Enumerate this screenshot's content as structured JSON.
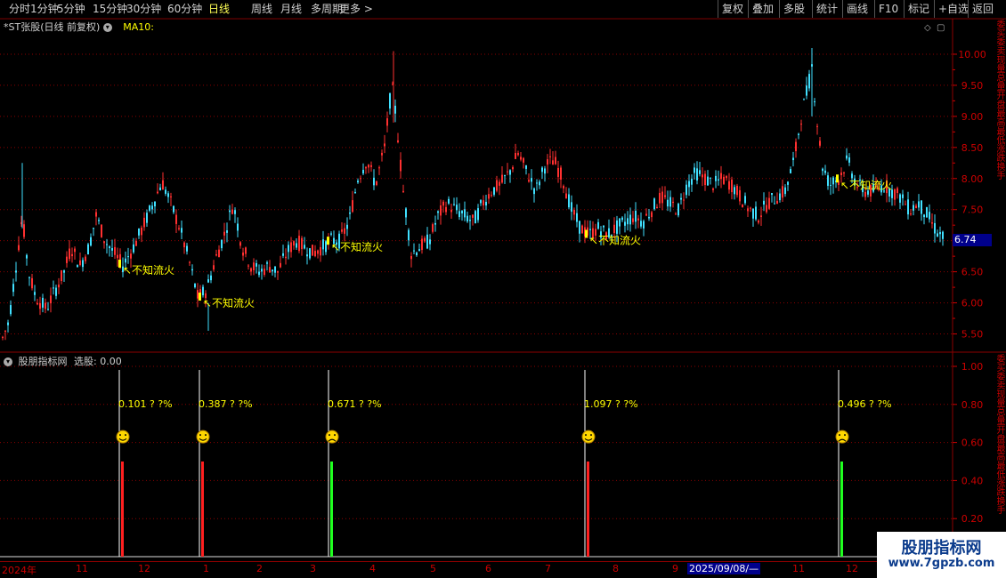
{
  "toolbar": {
    "periods": [
      {
        "label": "分时",
        "active": false
      },
      {
        "label": "1分钟",
        "active": false
      },
      {
        "label": "5分钟",
        "active": false
      },
      {
        "label": "15分钟",
        "active": false
      },
      {
        "label": "30分钟",
        "active": false
      },
      {
        "label": "60分钟",
        "active": false
      },
      {
        "label": "日线",
        "active": true
      },
      {
        "label": "周线",
        "active": false
      },
      {
        "label": "月线",
        "active": false
      },
      {
        "label": "多周期",
        "active": false
      },
      {
        "label": "更多 >",
        "active": false
      }
    ],
    "right_buttons": [
      "复权",
      "叠加",
      "多股",
      "统计",
      "画线",
      "F10",
      "标记",
      "+自选",
      "返回"
    ]
  },
  "main_chart": {
    "title": "*ST张股(日线 前复权)",
    "ma_label": "MA10:",
    "price_ticks": [
      "10.00",
      "9.50",
      "9.00",
      "8.50",
      "8.00",
      "7.50",
      "7.00",
      "6.50",
      "6.00",
      "5.50"
    ],
    "current_price": "6.74",
    "annotation_text": "不知流火",
    "annotations": [
      {
        "x": 138,
        "price": 6.58
      },
      {
        "x": 228,
        "price": 6.05
      },
      {
        "x": 372,
        "price": 6.95
      },
      {
        "x": 662,
        "price": 7.06
      },
      {
        "x": 944,
        "price": 7.95
      }
    ]
  },
  "indicator_panel": {
    "title": "股朋指标网",
    "select_label": "选股: 0.00",
    "y_ticks": [
      "1.00",
      "0.80",
      "0.60",
      "0.40",
      "0.20"
    ],
    "signals": [
      {
        "x": 136,
        "value": "0.101",
        "pct": "? ?%",
        "face": "happy",
        "bar_color": "#ff2020"
      },
      {
        "x": 226,
        "value": "0.387",
        "pct": "? ?%",
        "face": "happy",
        "bar_color": "#ff2020"
      },
      {
        "x": 371,
        "value": "0.671",
        "pct": "? ?%",
        "face": "sad",
        "bar_color": "#20ff20"
      },
      {
        "x": 659,
        "value": "1.097",
        "pct": "? ?%",
        "face": "happy",
        "bar_color": "#ff2020"
      },
      {
        "x": 944,
        "value": "0.496",
        "pct": "? ?%",
        "face": "sad",
        "bar_color": "#20ff20"
      }
    ]
  },
  "time_axis": {
    "labels": [
      {
        "text": "2024年",
        "x": 2
      },
      {
        "text": "11",
        "x": 85
      },
      {
        "text": "12",
        "x": 155
      },
      {
        "text": "1",
        "x": 228
      },
      {
        "text": "2",
        "x": 288
      },
      {
        "text": "3",
        "x": 348
      },
      {
        "text": "4",
        "x": 415
      },
      {
        "text": "5",
        "x": 483
      },
      {
        "text": "6",
        "x": 545
      },
      {
        "text": "7",
        "x": 612
      },
      {
        "text": "8",
        "x": 688
      },
      {
        "text": "9",
        "x": 755
      },
      {
        "text": "11",
        "x": 890
      },
      {
        "text": "12",
        "x": 950
      }
    ],
    "cursor_date": "2025/09/08/—"
  },
  "watermark": {
    "title": "股朋指标网",
    "url": "www.7gpzb.com"
  },
  "right_strip_text": "委买委卖现量总量开盘最高最低涨跌换手",
  "colors": {
    "up": "#ff3030",
    "down": "#40e0ff",
    "grid": "#8b0000",
    "annotation": "#ffff00"
  }
}
